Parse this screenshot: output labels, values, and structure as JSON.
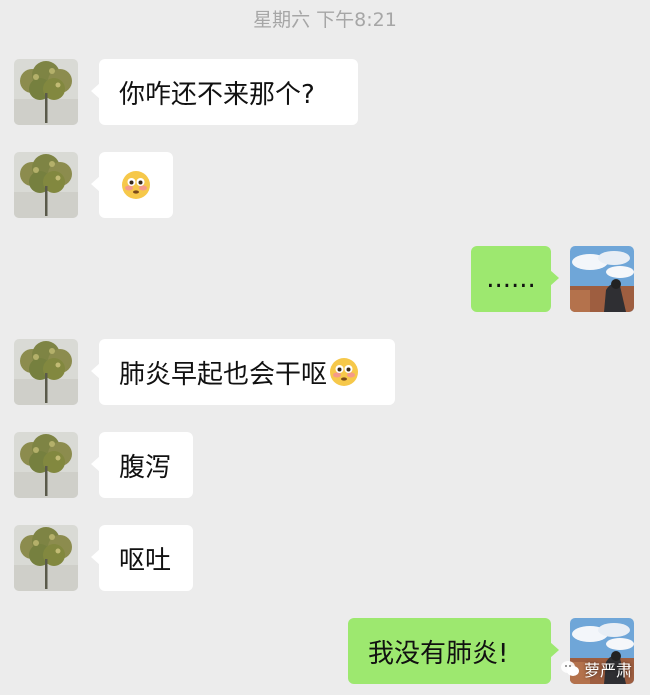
{
  "header": {
    "timestamp": "星期六 下午8:21"
  },
  "messages": [
    {
      "side": "in",
      "text": "你咋还不来那个?",
      "emoji": ""
    },
    {
      "side": "in",
      "text": "",
      "emoji": "flushed-face-icon"
    },
    {
      "side": "out",
      "text": "......",
      "emoji": ""
    },
    {
      "side": "in",
      "text": "肺炎早起也会干呕",
      "emoji": "flushed-face-icon"
    },
    {
      "side": "in",
      "text": "腹泻",
      "emoji": ""
    },
    {
      "side": "in",
      "text": "呕吐",
      "emoji": ""
    },
    {
      "side": "out",
      "text": "我没有肺炎!",
      "emoji": ""
    }
  ],
  "watermark": {
    "text": "萝严肃"
  },
  "colors": {
    "background": "#ececec",
    "incoming_bubble": "#ffffff",
    "outgoing_bubble": "#9de86f",
    "timestamp": "#a6a6a6"
  }
}
